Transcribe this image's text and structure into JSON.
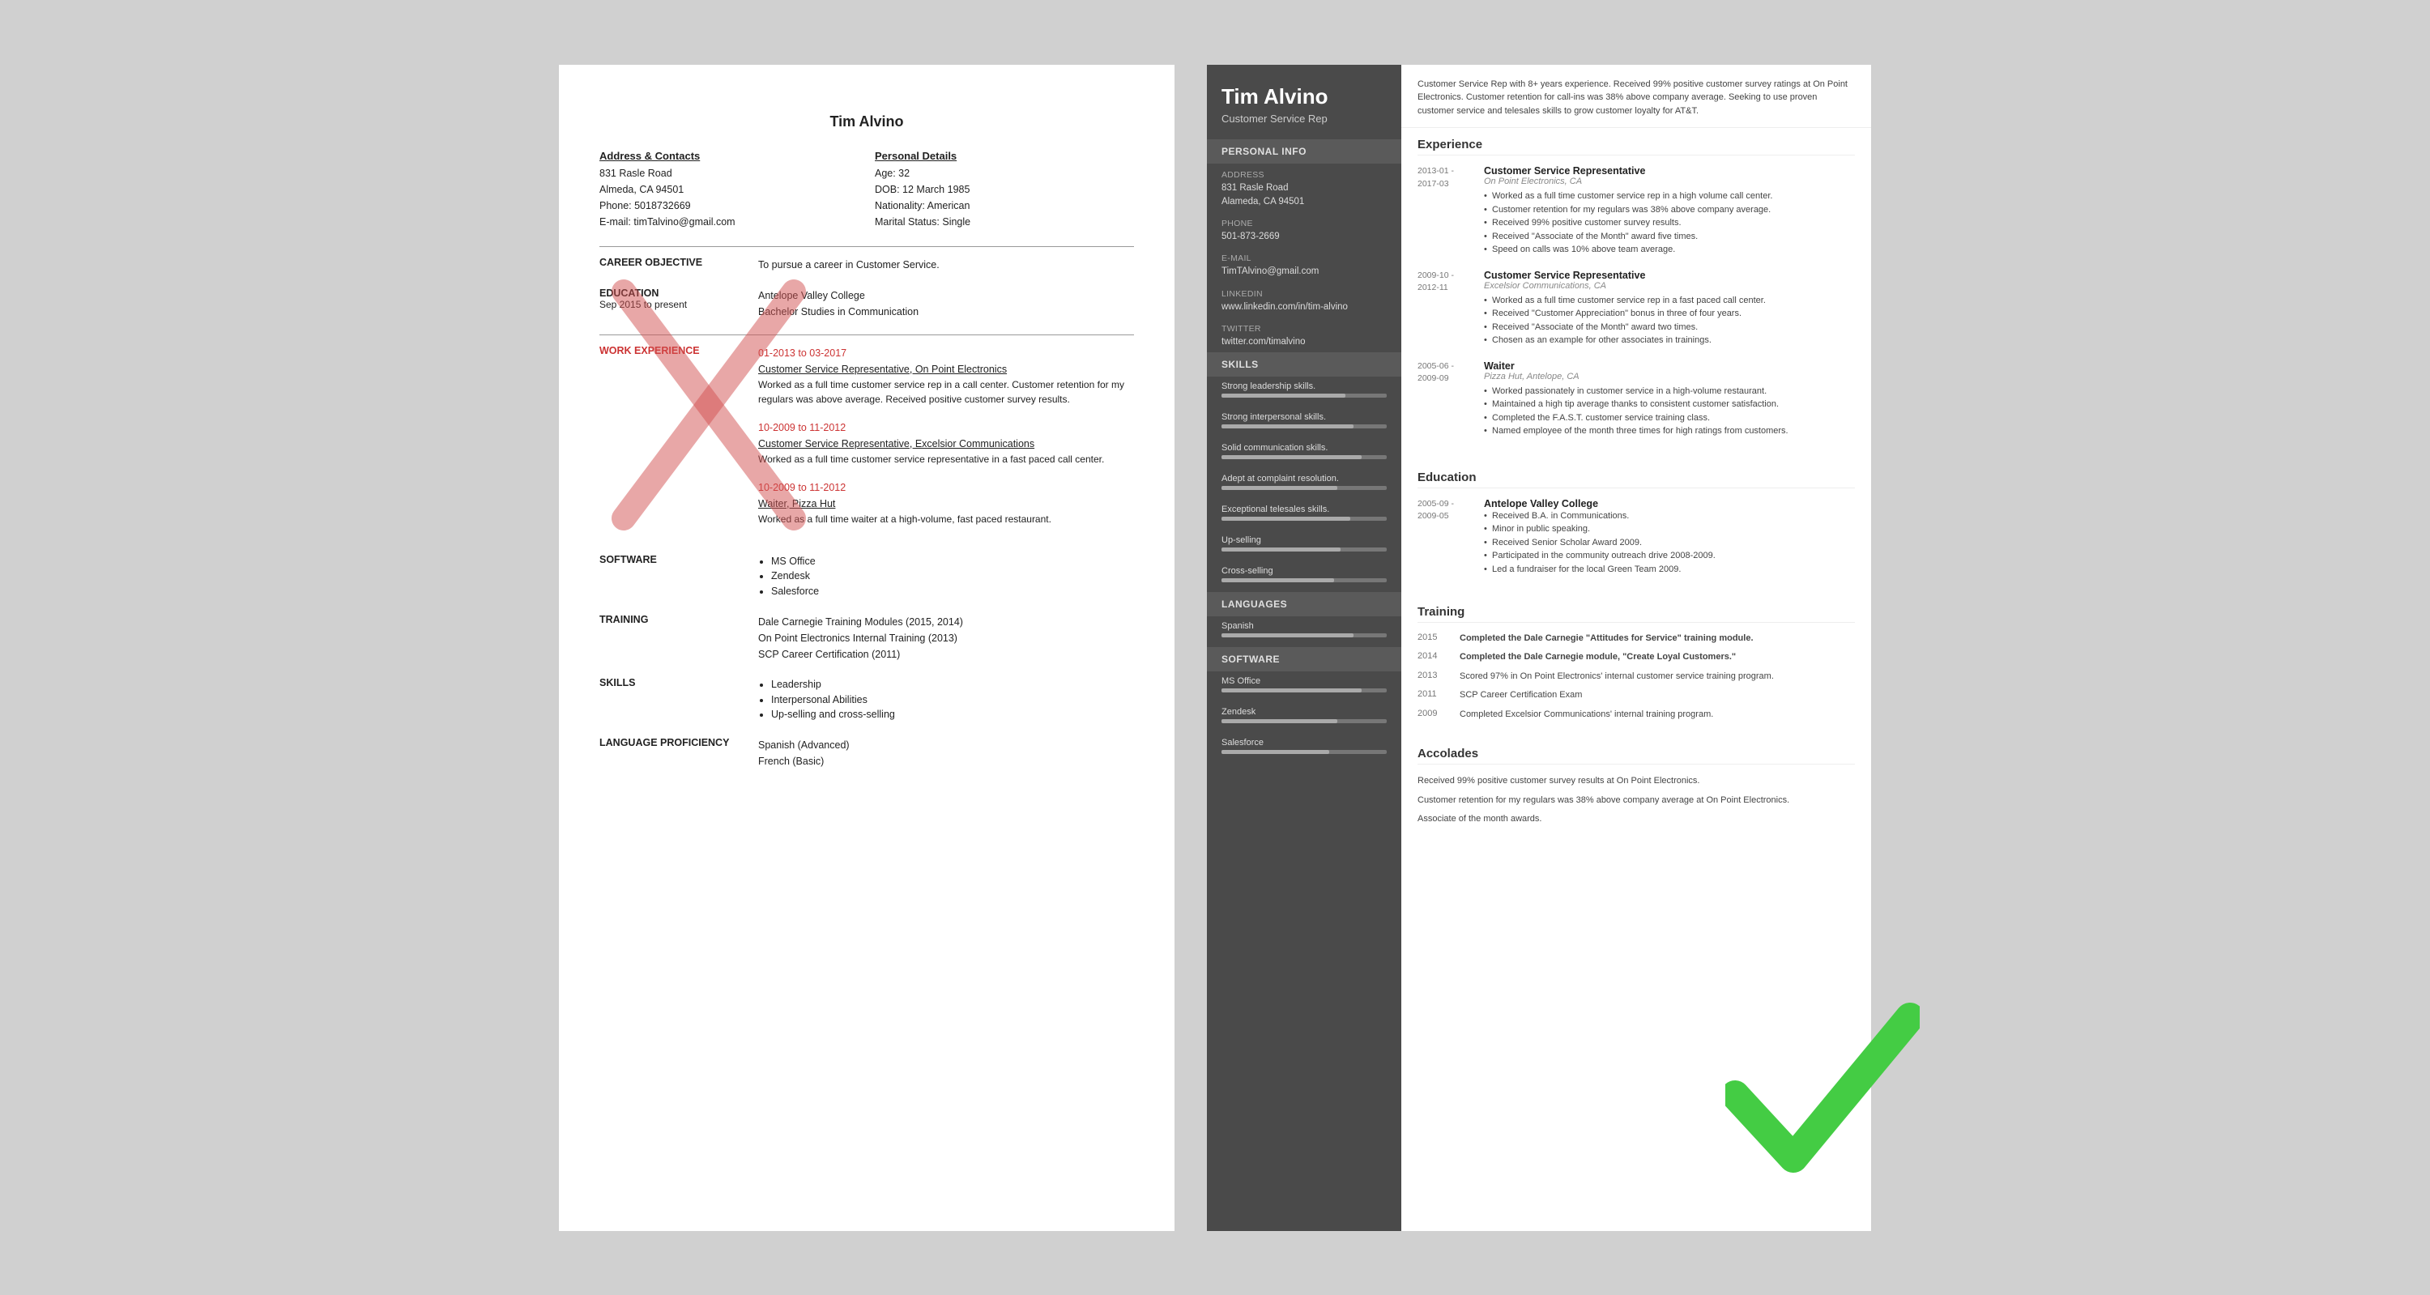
{
  "bad_resume": {
    "name": "Tim Alvino",
    "contact_left_label": "Address & Contacts",
    "address": "831 Rasle Road",
    "city_state": "Almeda, CA 94501",
    "phone": "Phone: 5018732669",
    "email": "E-mail: timTalvino@gmail.com",
    "contact_right_label": "Personal Details",
    "age": "Age:   32",
    "dob": "DOB:  12 March 1985",
    "nationality": "Nationality: American",
    "marital": "Marital Status: Single",
    "career_label": "CAREER OBJECTIVE",
    "career_text": "To pursue a career in Customer Service.",
    "education_label": "EDUCATION",
    "edu_dates": "Sep 2015 to present",
    "edu_school": "Antelope Valley College",
    "edu_degree": "Bachelor Studies in Communication",
    "work_label": "WORK EXPERIENCE",
    "work_items": [
      {
        "dates": "01-2013 to 03-2017",
        "title_link": "Customer Service Representative, On Point Electronics",
        "desc": "Worked as a full time customer service rep in a call center. Customer retention for my regulars was above average. Received positive customer survey results."
      },
      {
        "dates": "10-2009 to 11-2012",
        "title_link": "Customer Service Representative, Excelsior Communications",
        "desc": "Worked as a full time customer service representative in a fast paced call center."
      },
      {
        "dates": "10-2009 to 11-2012",
        "title_link": "Waiter, Pizza Hut",
        "desc": "Worked as a full time waiter at a high-volume, fast paced restaurant."
      }
    ],
    "software_label": "SOFTWARE",
    "software_items": [
      "MS Office",
      "Zendesk",
      "Salesforce"
    ],
    "training_label": "TRAINING",
    "training_items": [
      "Dale Carnegie Training Modules (2015, 2014)",
      "On Point Electronics Internal Training (2013)",
      "SCP Career Certification (2011)"
    ],
    "skills_label": "SKILLS",
    "skills_items": [
      "Leadership",
      "Interpersonal Abilities",
      "Up-selling and cross-selling"
    ],
    "language_label": "LANGUAGE PROFICIENCY",
    "language_items": [
      "Spanish (Advanced)",
      "French (Basic)"
    ]
  },
  "good_resume": {
    "name": "Tim Alvino",
    "title": "Customer Service Rep",
    "summary": "Customer Service Rep with 8+ years experience. Received 99% positive customer survey ratings at On Point Electronics. Customer retention for call-ins was 38% above company average. Seeking to use proven customer service and telesales skills to grow customer loyalty for AT&T.",
    "personal_info_label": "Personal Info",
    "address_label": "Address",
    "address": "831 Rasle Road",
    "city": "Alameda, CA 94501",
    "phone_label": "Phone",
    "phone": "501-873-2669",
    "email_label": "E-mail",
    "email": "TimTAlvino@gmail.com",
    "linkedin_label": "LinkedIn",
    "linkedin": "www.linkedin.com/in/tim-alvino",
    "twitter_label": "Twitter",
    "twitter": "twitter.com/timalvino",
    "skills_label": "Skills",
    "skills": [
      {
        "label": "Strong leadership skills.",
        "pct": 75
      },
      {
        "label": "Strong interpersonal skills.",
        "pct": 80
      },
      {
        "label": "Solid communication skills.",
        "pct": 85
      },
      {
        "label": "Adept at complaint resolution.",
        "pct": 70
      },
      {
        "label": "Exceptional telesales skills.",
        "pct": 78
      },
      {
        "label": "Up-selling",
        "pct": 72
      },
      {
        "label": "Cross-selling",
        "pct": 68
      }
    ],
    "languages_label": "Languages",
    "languages": [
      {
        "label": "Spanish",
        "pct": 80
      }
    ],
    "software_label": "Software",
    "software": [
      {
        "label": "MS Office",
        "pct": 85
      },
      {
        "label": "Zendesk",
        "pct": 70
      },
      {
        "label": "Salesforce",
        "pct": 65
      }
    ],
    "experience_label": "Experience",
    "experience": [
      {
        "dates": "2013-01 -\n2017-03",
        "title": "Customer Service Representative",
        "company": "On Point Electronics, CA",
        "bullets": [
          "Worked as a full time customer service rep in a high volume call center.",
          "Customer retention for my regulars was 38% above company average.",
          "Received 99% positive customer survey results.",
          "Received \"Associate of the Month\" award five times.",
          "Speed on calls was 10% above team average."
        ]
      },
      {
        "dates": "2009-10 -\n2012-11",
        "title": "Customer Service Representative",
        "company": "Excelsior Communications, CA",
        "bullets": [
          "Worked as a full time customer service rep in a fast paced call center.",
          "Received \"Customer Appreciation\" bonus in three of four years.",
          "Received \"Associate of the Month\" award two times.",
          "Chosen as an example for other associates in trainings."
        ]
      },
      {
        "dates": "2005-06 -\n2009-09",
        "title": "Waiter",
        "company": "Pizza Hut, Antelope, CA",
        "bullets": [
          "Worked passionately in customer service in a high-volume restaurant.",
          "Maintained a high tip average thanks to consistent customer satisfaction.",
          "Completed the F.A.S.T. customer service training class.",
          "Named employee of the month three times for high ratings from customers."
        ]
      }
    ],
    "education_label": "Education",
    "education": [
      {
        "dates": "2005-09 -\n2009-05",
        "school": "Antelope Valley College",
        "bullets": [
          "Received B.A. in Communications.",
          "Minor in public speaking.",
          "Received Senior Scholar Award 2009.",
          "Participated in the community outreach drive 2008-2009.",
          "Led a fundraiser for the local Green Team 2009."
        ]
      }
    ],
    "training_label": "Training",
    "training": [
      {
        "year": "2015",
        "desc": "Completed the Dale Carnegie \"Attitudes for Service\" training module.",
        "bold": true
      },
      {
        "year": "2014",
        "desc": "Completed the Dale Carnegie module, \"Create Loyal Customers.\"",
        "bold": true
      },
      {
        "year": "2013",
        "desc": "Scored 97% in On Point Electronics' internal customer service training program.",
        "bold": false
      },
      {
        "year": "2011",
        "desc": "SCP Career Certification Exam",
        "bold": false
      },
      {
        "year": "2009",
        "desc": "Completed Excelsior Communications' internal training program.",
        "bold": false
      }
    ],
    "accolades_label": "Accolades",
    "accolades": [
      "Received 99% positive customer survey results at On Point Electronics.",
      "Customer retention for my regulars was 38% above company average at On Point Electronics.",
      "Associate of the month awards."
    ]
  }
}
